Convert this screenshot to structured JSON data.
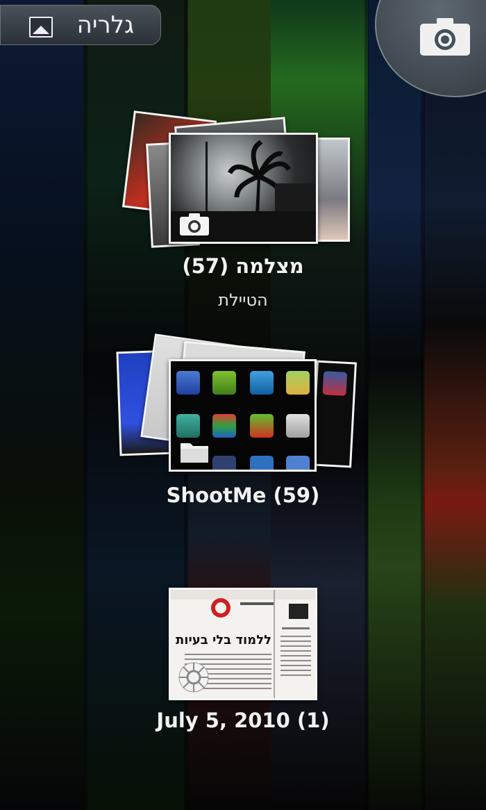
{
  "app": {
    "gallery_label": "גלריה",
    "gallery_icon": "gallery-image-icon",
    "camera_icon": "camera-icon"
  },
  "albums": [
    {
      "title": "מצלמה  (57)",
      "subtitle": "הטיילת",
      "badge_icon": "camera-badge-icon"
    },
    {
      "title": "ShootMe  (59)",
      "subtitle": "",
      "badge_icon": "folder-badge-icon"
    },
    {
      "title": "July 5, 2010  (1)",
      "subtitle": "",
      "badge_icon": "picasa-badge-icon",
      "thumb_headline": "ללמוד בלי בעיות"
    }
  ],
  "colors": {
    "pill_bg": "#3a4248",
    "text": "#f2f2f2",
    "photo_border": "#f4f4f4"
  }
}
